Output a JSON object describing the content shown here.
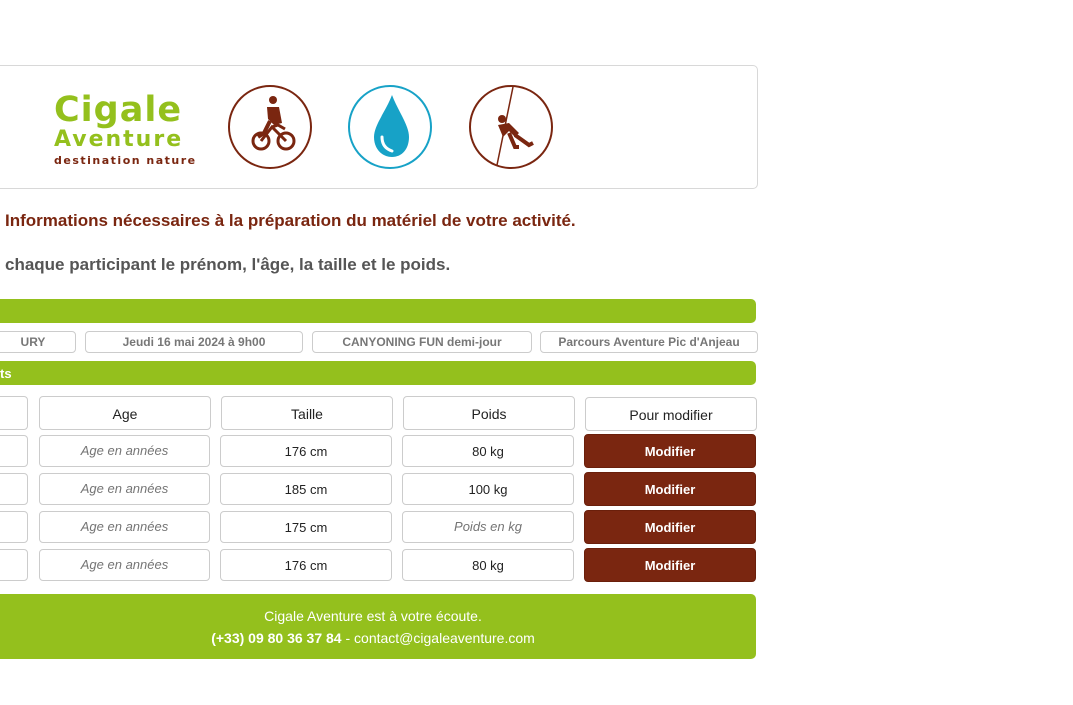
{
  "logo": {
    "line1": "Cigale",
    "line2": "Aventure",
    "line3": "destination nature"
  },
  "icons": [
    "cycling-icon",
    "water-drop-icon",
    "abseiling-icon"
  ],
  "colors": {
    "brand_green": "#94c01d",
    "brand_brown": "#7a2610",
    "water_blue": "#17a2c7"
  },
  "intro": {
    "heading": "Informations nécessaires à la préparation du matériel de votre activité.",
    "instruction": "chaque participant le prénom, l'âge, la taille et le poids."
  },
  "booking": {
    "client": "URY",
    "date": "Jeudi 16 mai 2024 à 9h00",
    "activity": "CANYONING FUN demi-jour",
    "location": "Parcours Aventure Pic d'Anjeau"
  },
  "participants_bar_label": "ts",
  "table": {
    "headers": {
      "age": "Age",
      "taille": "Taille",
      "poids": "Poids",
      "action": "Pour modifier"
    },
    "age_placeholder": "Age en années",
    "poids_placeholder": "Poids en kg",
    "rows": [
      {
        "age": "",
        "taille": "176 cm",
        "poids": "80 kg",
        "button": "Modifier"
      },
      {
        "age": "",
        "taille": "185 cm",
        "poids": "100 kg",
        "button": "Modifier"
      },
      {
        "age": "",
        "taille": "175 cm",
        "poids": "",
        "button": "Modifier"
      },
      {
        "age": "",
        "taille": "176 cm",
        "poids": "80 kg",
        "button": "Modifier"
      }
    ]
  },
  "footer": {
    "line1": "Cigale Aventure est à votre écoute.",
    "phone": "(+33) 09 80 36 37 84",
    "separator": " - ",
    "email": "contact@cigaleaventure.com"
  }
}
